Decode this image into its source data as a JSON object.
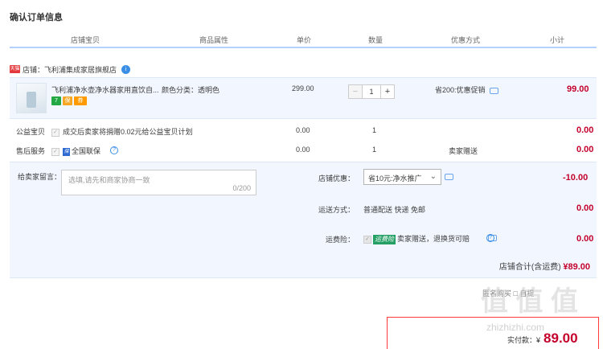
{
  "page_title": "确认订单信息",
  "columns": [
    "店铺宝贝",
    "商品属性",
    "单价",
    "数量",
    "优惠方式",
    "小计"
  ],
  "shop": {
    "badge": "天猫",
    "label": "店铺：飞利浦集成家居旗舰店",
    "info_icon": "info"
  },
  "item": {
    "name": "飞利浦净水壶净水器家用直饮自...",
    "attr": "颜色分类：透明色",
    "price": "299.00",
    "qty": "1",
    "minus": "−",
    "plus": "+",
    "promo": "省200:优惠促销",
    "subtotal": "99.00",
    "badges": [
      "7",
      "保",
      "券"
    ]
  },
  "charity": {
    "label": "公益宝贝",
    "text": "成交后卖家将捐赠0.02元给公益宝贝计划",
    "price": "0.00",
    "qty": "1",
    "subtotal": "0.00"
  },
  "aftersale": {
    "label": "售后服务",
    "badge": "保",
    "text": "全国联保",
    "price": "0.00",
    "qty": "1",
    "promo": "卖家赠送",
    "subtotal": "0.00"
  },
  "message": {
    "label": "给卖家留言：",
    "placeholder": "选填,请先和商家协商一致",
    "count": "0/200"
  },
  "shop_discount": {
    "label": "店铺优惠：",
    "value": "省10元:净水推广",
    "amount": "-10.00"
  },
  "shipping": {
    "label": "运送方式：",
    "value": "普通配送 快递 免邮",
    "amount": "0.00"
  },
  "freight_insurance": {
    "label": "运费险：",
    "tag": "运费险",
    "text": "卖家赠送，退换货可赔",
    "amount": "0.00"
  },
  "shop_total": {
    "label": "店铺合计(含运费)",
    "amount": "¥89.00"
  },
  "ghost_text": "匿名购买    □ 自提",
  "watermark": {
    "main": "值 值 值",
    "sub": "zhizhizhi.com"
  },
  "pay": {
    "label": "实付款：",
    "currency": "¥",
    "amount": "89.00"
  },
  "colors": {
    "accent": "#c4002b",
    "row_bg": "#f2f7ff",
    "header_line": "#b2d1ff"
  }
}
